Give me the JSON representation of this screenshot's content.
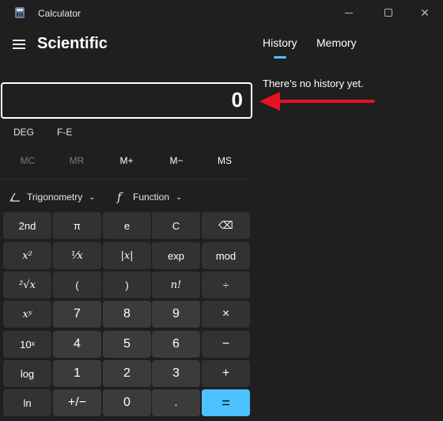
{
  "window": {
    "title": "Calculator",
    "minimize_glyph": "",
    "maximize_glyph": "",
    "close_glyph": "✕"
  },
  "header": {
    "mode_title": "Scientific"
  },
  "display": {
    "value": "0"
  },
  "angle_row": {
    "deg_label": "DEG",
    "fe_label": "F-E"
  },
  "memory_row": [
    "MC",
    "MR",
    "M+",
    "M−",
    "MS"
  ],
  "dropdowns": {
    "trigonometry": "Trigonometry",
    "function": "Function",
    "function_glyph": "f"
  },
  "keypad": {
    "r1": [
      "2nd",
      "π",
      "e",
      "C",
      "⌫"
    ],
    "r2": [
      "x²",
      "⅟x",
      "|x|",
      "exp",
      "mod"
    ],
    "r3": [
      "²√x",
      "(",
      ")",
      "n!",
      "÷"
    ],
    "r4": [
      "xʸ",
      "7",
      "8",
      "9",
      "×"
    ],
    "r5": [
      "10ˣ",
      "4",
      "5",
      "6",
      "−"
    ],
    "r6": [
      "log",
      "1",
      "2",
      "3",
      "+"
    ],
    "r7": [
      "ln",
      "+/−",
      "0",
      ".",
      "="
    ]
  },
  "history_pane": {
    "tabs": [
      "History",
      "Memory"
    ],
    "active_tab": "History",
    "empty_message": "There’s no history yet."
  },
  "colors": {
    "background": "#1f1f1f",
    "accent": "#4cc2ff",
    "annotation_arrow": "#e81123"
  }
}
